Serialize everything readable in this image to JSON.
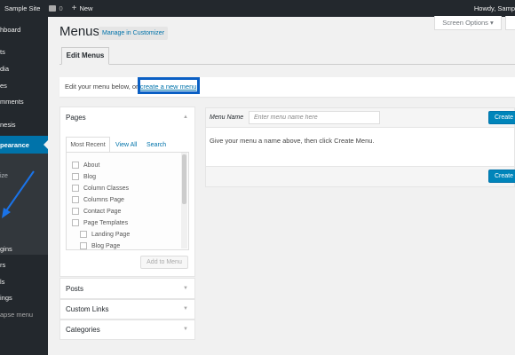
{
  "admin_bar": {
    "site_name": "Sample Site",
    "comment_count": "0",
    "new_label": "New",
    "howdy": "Howdy, Samp"
  },
  "sidebar": {
    "items": [
      {
        "label": "hboard"
      },
      {
        "label": "ts"
      },
      {
        "label": "dia"
      },
      {
        "label": "es"
      },
      {
        "label": "mments"
      },
      {
        "label": "nesis"
      },
      {
        "label": "pearance"
      },
      {
        "label": "ize"
      },
      {
        "label": "gins"
      },
      {
        "label": "rs"
      },
      {
        "label": "ls"
      },
      {
        "label": "ings"
      },
      {
        "label": "apse menu"
      }
    ]
  },
  "header": {
    "title": "Menus",
    "customizer_button": "Manage in Customizer",
    "screen_options": "Screen Options ▾"
  },
  "tabs": {
    "edit_menus": "Edit Menus"
  },
  "notice": {
    "text": "Edit your menu below, or ",
    "link": "create a new menu",
    "suffix": "."
  },
  "pages_box": {
    "title": "Pages",
    "tabs": [
      "Most Recent",
      "View All",
      "Search"
    ],
    "items": [
      "About",
      "Blog",
      "Column Classes",
      "Columns Page",
      "Contact Page",
      "Page Templates",
      "Landing Page",
      "Blog Page"
    ],
    "add_button": "Add to Menu"
  },
  "other_boxes": [
    "Posts",
    "Custom Links",
    "Categories"
  ],
  "menu_editor": {
    "name_label": "Menu Name",
    "name_placeholder": "Enter menu name here",
    "create_button": "Create",
    "body_text": "Give your menu a name above, then click Create Menu."
  },
  "colors": {
    "admin_dark": "#23282d",
    "accent": "#0073aa",
    "highlight_box": "#0a5fc4",
    "annotation_arrow": "#1a73e8"
  }
}
